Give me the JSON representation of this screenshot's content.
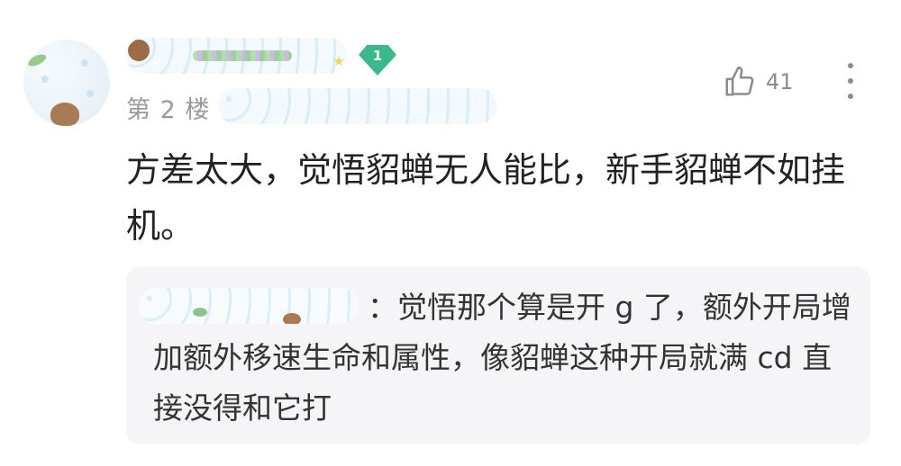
{
  "comment": {
    "level_badge": "1",
    "floor_label": "第 2 楼",
    "like_count": "41",
    "text": "方差太大，觉悟貂蝉无人能比，新手貂蝉不如挂机。"
  },
  "reply": {
    "separator": "：",
    "text": "：觉悟那个算是开 g 了，额外开局增加额外移速生命和属性，像貂蝉这种开局就满 cd 直接没得和它打"
  },
  "icons": {
    "like": "thumbs-up-icon",
    "more": "more-vertical-icon",
    "level": "gem-badge-icon"
  },
  "colors": {
    "badge": "#3bb98b",
    "muted": "#9a9a9a",
    "text": "#222222",
    "reply_bg": "#f5f5f7"
  }
}
